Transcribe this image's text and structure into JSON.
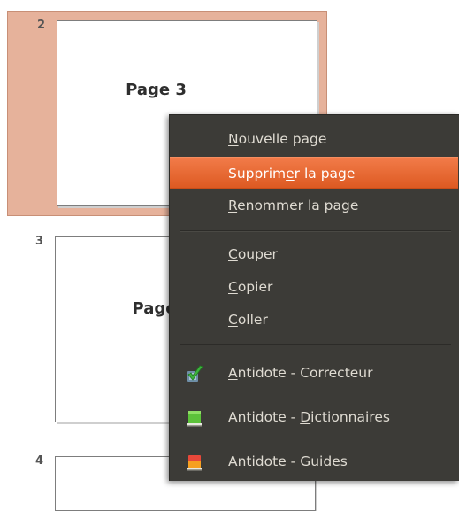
{
  "slides": [
    {
      "number": "2",
      "title": "Page 3",
      "selected": true
    },
    {
      "number": "3",
      "title": "Page"
    },
    {
      "number": "4",
      "title": ""
    }
  ],
  "context_menu": {
    "items": [
      {
        "pre": "",
        "mn": "N",
        "post": "ouvelle page",
        "highlighted": false
      },
      {
        "pre": "Supprim",
        "mn": "e",
        "post": "r la page",
        "highlighted": true
      },
      {
        "pre": "",
        "mn": "R",
        "post": "enommer la page",
        "highlighted": false
      },
      {
        "pre": "",
        "mn": "C",
        "post": "ouper",
        "highlighted": false
      },
      {
        "pre": "",
        "mn": "C",
        "post": "opier",
        "highlighted": false
      },
      {
        "pre": "",
        "mn": "C",
        "post": "oller",
        "highlighted": false
      },
      {
        "pre": "",
        "mn": "A",
        "post": "ntidote - Correcteur",
        "icon": "antidote-correcteur-icon"
      },
      {
        "pre": "Antidote - ",
        "mn": "D",
        "post": "ictionnaires",
        "icon": "antidote-dictionnaires-icon"
      },
      {
        "pre": "Antidote - ",
        "mn": "G",
        "post": "uides",
        "icon": "antidote-guides-icon"
      }
    ]
  },
  "colors": {
    "selection_bg": "#e6b29b",
    "menu_bg": "#3c3b37",
    "menu_text": "#dfdbd2",
    "highlight": "#e8652e"
  }
}
